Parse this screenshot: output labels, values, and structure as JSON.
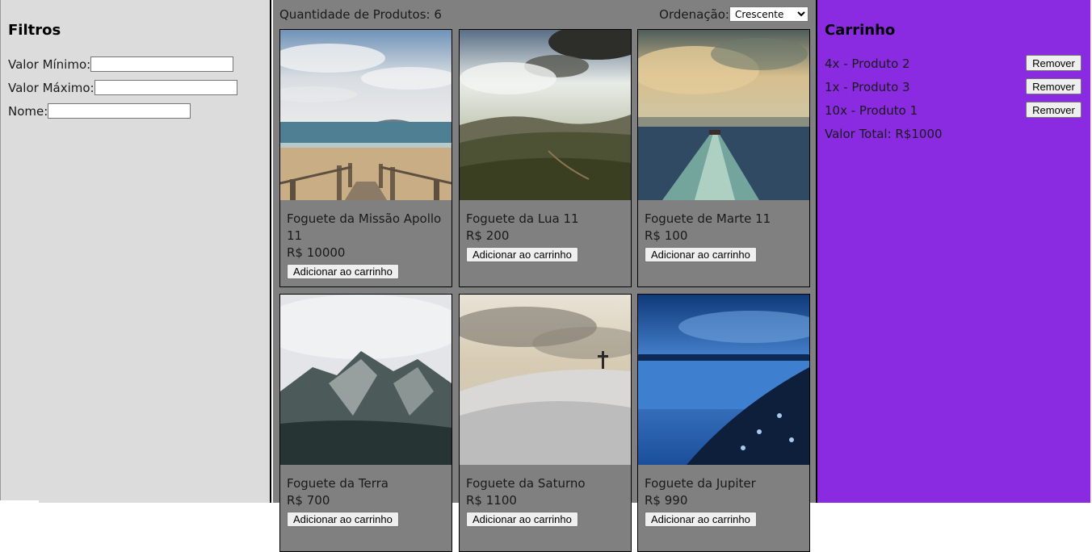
{
  "filters": {
    "title": "Filtros",
    "min_label": "Valor Mínimo:",
    "max_label": "Valor Máximo:",
    "name_label": "Nome:",
    "min_value": "",
    "max_value": "",
    "name_value": ""
  },
  "products_panel": {
    "count_text": "Quantidade de Produtos: 6",
    "sort_label": "Ordenação:",
    "sort_selected": "Crescente",
    "add_label": "Adicionar ao carrinho",
    "items": [
      {
        "name": "Foguete da Missão Apollo 11",
        "price": "R$ 10000",
        "image": "beach-boardwalk-photo"
      },
      {
        "name": "Foguete da Lua 11",
        "price": "R$ 200",
        "image": "valley-landscape-photo"
      },
      {
        "name": "Foguete de Marte 11",
        "price": "R$ 100",
        "image": "boat-wake-sea-photo"
      },
      {
        "name": "Foguete da Terra",
        "price": "R$ 700",
        "image": "misty-mountain-photo"
      },
      {
        "name": "Foguete da Saturno",
        "price": "R$ 1100",
        "image": "snowy-hill-cross-photo"
      },
      {
        "name": "Foguete da Jupiter",
        "price": "R$ 990",
        "image": "blue-shore-night-photo"
      }
    ]
  },
  "cart": {
    "title": "Carrinho",
    "remove_label": "Remover",
    "items": [
      {
        "text": "4x - Produto 2"
      },
      {
        "text": "1x - Produto 3"
      },
      {
        "text": "10x - Produto 1"
      }
    ],
    "total_text": "Valor Total: R$1000"
  }
}
